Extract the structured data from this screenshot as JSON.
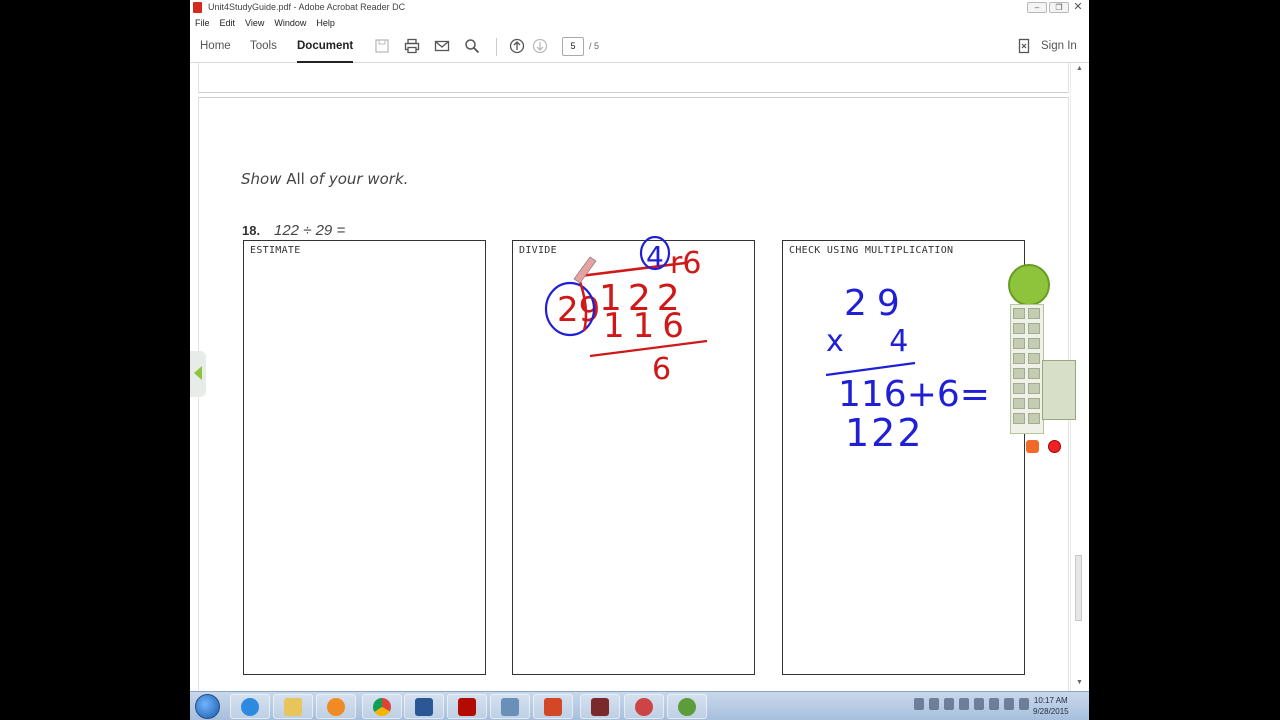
{
  "window": {
    "title": "Unit4StudyGuide.pdf - Adobe Acrobat Reader DC",
    "controls": {
      "minimize": "–",
      "restore": "❐",
      "close": "✕"
    }
  },
  "menu": [
    "File",
    "Edit",
    "View",
    "Window",
    "Help"
  ],
  "toolbar": {
    "tabs": [
      "Home",
      "Tools",
      "Document"
    ],
    "active_tab": "Document",
    "current_page": "5",
    "total_pages": "/ 5",
    "sign_in": "Sign In"
  },
  "document": {
    "instructions_before": "Show ",
    "instructions_bold": "All",
    "instructions_after": " of your work.",
    "question_number": "18.",
    "question_expression": "122 ÷ 29 =",
    "boxes": [
      {
        "label": "ESTIMATE"
      },
      {
        "label": "DIVIDE"
      },
      {
        "label": "CHECK USING MULTIPLICATION"
      }
    ]
  },
  "handwriting": {
    "divide": {
      "divisor": "29",
      "dividend": "122",
      "quotient": "4",
      "remainder_label": "r6",
      "product": "116",
      "difference": "6"
    },
    "check": {
      "line1": "29",
      "line2": "x 4",
      "line3": "116+6=",
      "line4": "122"
    }
  },
  "colors": {
    "accent_green": "#8ec43b",
    "ink_blue": "#1f1fd6",
    "ink_red": "#d01818",
    "taskbar": "#b5c9e2"
  },
  "taskbar": {
    "clock_time": "10:17 AM",
    "clock_date": "9/28/2015"
  }
}
